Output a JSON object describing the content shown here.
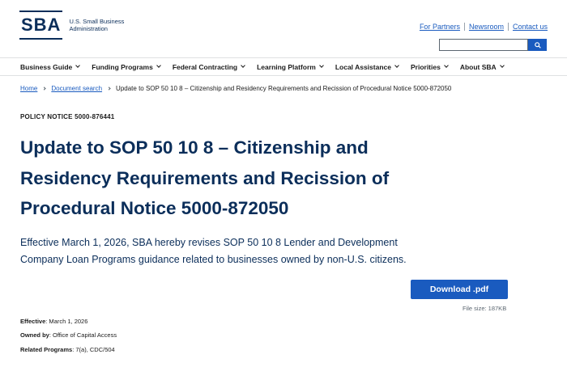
{
  "header": {
    "logo_mark": "SBA",
    "logo_line1": "U.S. Small Business",
    "logo_line2": "Administration",
    "links": [
      "For Partners",
      "Newsroom",
      "Contact us"
    ],
    "search_placeholder": ""
  },
  "nav": {
    "items": [
      "Business Guide",
      "Funding Programs",
      "Federal Contracting",
      "Learning Platform",
      "Local Assistance",
      "Priorities",
      "About SBA"
    ]
  },
  "breadcrumb": {
    "home": "Home",
    "section": "Document search",
    "current": "Update to SOP 50 10 8 – Citizenship and Residency Requirements and Recission of Procedural Notice 5000-872050"
  },
  "document": {
    "notice_label": "POLICY NOTICE 5000-876441",
    "title": "Update to SOP 50 10 8 – Citizenship and Residency Requirements and Recission of Procedural Notice 5000-872050",
    "summary": "Effective March 1, 2026, SBA hereby revises SOP 50 10 8 Lender and Development Company Loan Programs guidance related to businesses owned by non-U.S. citizens.",
    "download_label": "Download .pdf",
    "file_size": "File size: 187KB",
    "effective_label": "Effective",
    "effective_value": ": March 1, 2026",
    "owned_label": "Owned by",
    "owned_value": ": Office of Capital Access",
    "programs_label": "Related Programs",
    "programs_value": ": 7(a), CDC/504"
  },
  "colors": {
    "brand_navy": "#0b2e5a",
    "link_blue": "#1a5bbf"
  },
  "icons": {
    "search": "search-icon",
    "chevron": "chevron-down-icon"
  }
}
